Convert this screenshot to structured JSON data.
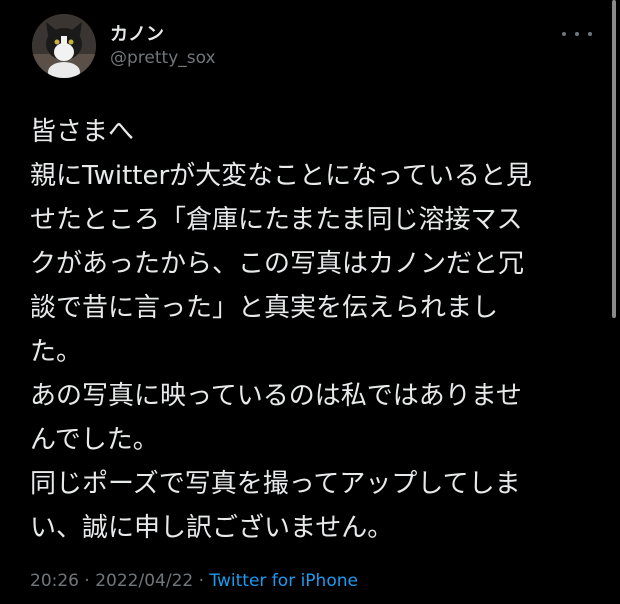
{
  "user": {
    "display_name": "カノン",
    "handle": "@pretty_sox"
  },
  "tweet": {
    "lines": [
      "皆さまへ",
      "親にTwitterが大変なことになっていると見",
      "せたところ「倉庫にたまたま同じ溶接マス",
      "クがあったから、この写真はカノンだと冗",
      "談で昔に言った」と真実を伝えられまし",
      "た。",
      "あの写真に映っているのは私ではありませ",
      "んでした。",
      "同じポーズで写真を撮ってアップしてしま",
      "い、誠に申し訳ございません。"
    ]
  },
  "meta": {
    "time": "20:26",
    "separator1": " · ",
    "date": "2022/04/22",
    "separator2": " · ",
    "source": "Twitter for iPhone"
  },
  "icons": {
    "avatar": "cat-avatar",
    "more": "more-horizontal-icon"
  },
  "colors": {
    "background": "#000000",
    "text": "#e7e9ea",
    "secondary": "#71767b",
    "link": "#1d9bf0"
  }
}
